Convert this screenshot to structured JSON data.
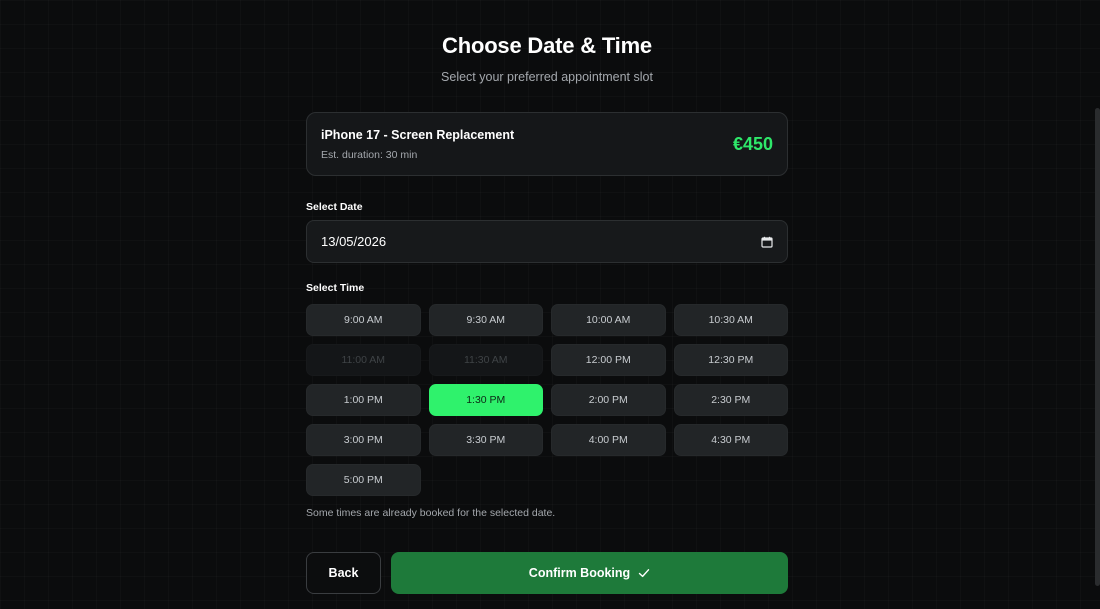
{
  "header": {
    "title": "Choose Date & Time",
    "subtitle": "Select your preferred appointment slot"
  },
  "service": {
    "name": "iPhone 17 - Screen Replacement",
    "duration": "Est. duration: 30 min",
    "price": "€450"
  },
  "date": {
    "label": "Select Date",
    "value": "13/05/2026",
    "icon": "calendar-icon"
  },
  "time": {
    "label": "Select Time",
    "slots": [
      {
        "label": "9:00 AM",
        "state": "available"
      },
      {
        "label": "9:30 AM",
        "state": "available"
      },
      {
        "label": "10:00 AM",
        "state": "available"
      },
      {
        "label": "10:30 AM",
        "state": "available"
      },
      {
        "label": "11:00 AM",
        "state": "booked"
      },
      {
        "label": "11:30 AM",
        "state": "booked"
      },
      {
        "label": "12:00 PM",
        "state": "available"
      },
      {
        "label": "12:30 PM",
        "state": "available"
      },
      {
        "label": "1:00 PM",
        "state": "available"
      },
      {
        "label": "1:30 PM",
        "state": "selected"
      },
      {
        "label": "2:00 PM",
        "state": "available"
      },
      {
        "label": "2:30 PM",
        "state": "available"
      },
      {
        "label": "3:00 PM",
        "state": "available"
      },
      {
        "label": "3:30 PM",
        "state": "available"
      },
      {
        "label": "4:00 PM",
        "state": "available"
      },
      {
        "label": "4:30 PM",
        "state": "available"
      },
      {
        "label": "5:00 PM",
        "state": "available"
      }
    ],
    "note": "Some times are already booked for the selected date."
  },
  "actions": {
    "back_label": "Back",
    "confirm_label": "Confirm Booking",
    "confirm_icon": "check-icon"
  },
  "colors": {
    "accent": "#2ff26c",
    "price": "#2ee86a",
    "confirm_bg": "#1e7a3a",
    "background": "#0b0c0d"
  }
}
